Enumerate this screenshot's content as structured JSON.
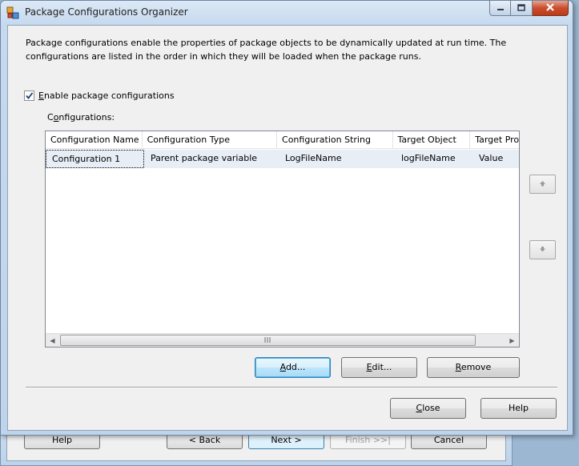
{
  "window": {
    "title": "Package Configurations Organizer"
  },
  "description": "Package configurations enable the properties of package objects to be dynamically updated at run time. The configurations are listed in the order in which they will be loaded when the package runs.",
  "enable_checkbox": {
    "label": "Enable package configurations",
    "checked": true
  },
  "configurations_label": "Configurations:",
  "grid": {
    "columns": [
      "Configuration Name",
      "Configuration Type",
      "Configuration String",
      "Target Object",
      "Target Pro"
    ],
    "rows": [
      [
        "Configuration 1",
        "Parent package variable",
        "LogFileName",
        "logFileName",
        "Value"
      ]
    ]
  },
  "buttons": {
    "add": "Add...",
    "edit": "Edit...",
    "remove": "Remove",
    "close": "Close",
    "help": "Help"
  },
  "background_wizard": {
    "help": "Help",
    "back": "< Back",
    "next": "Next >",
    "finish": "Finish >>|",
    "cancel": "Cancel"
  },
  "colors": {
    "selected_row": "#e8eef6",
    "default_button_border": "#3c7fb1",
    "close_caption": "#c94d2e"
  }
}
